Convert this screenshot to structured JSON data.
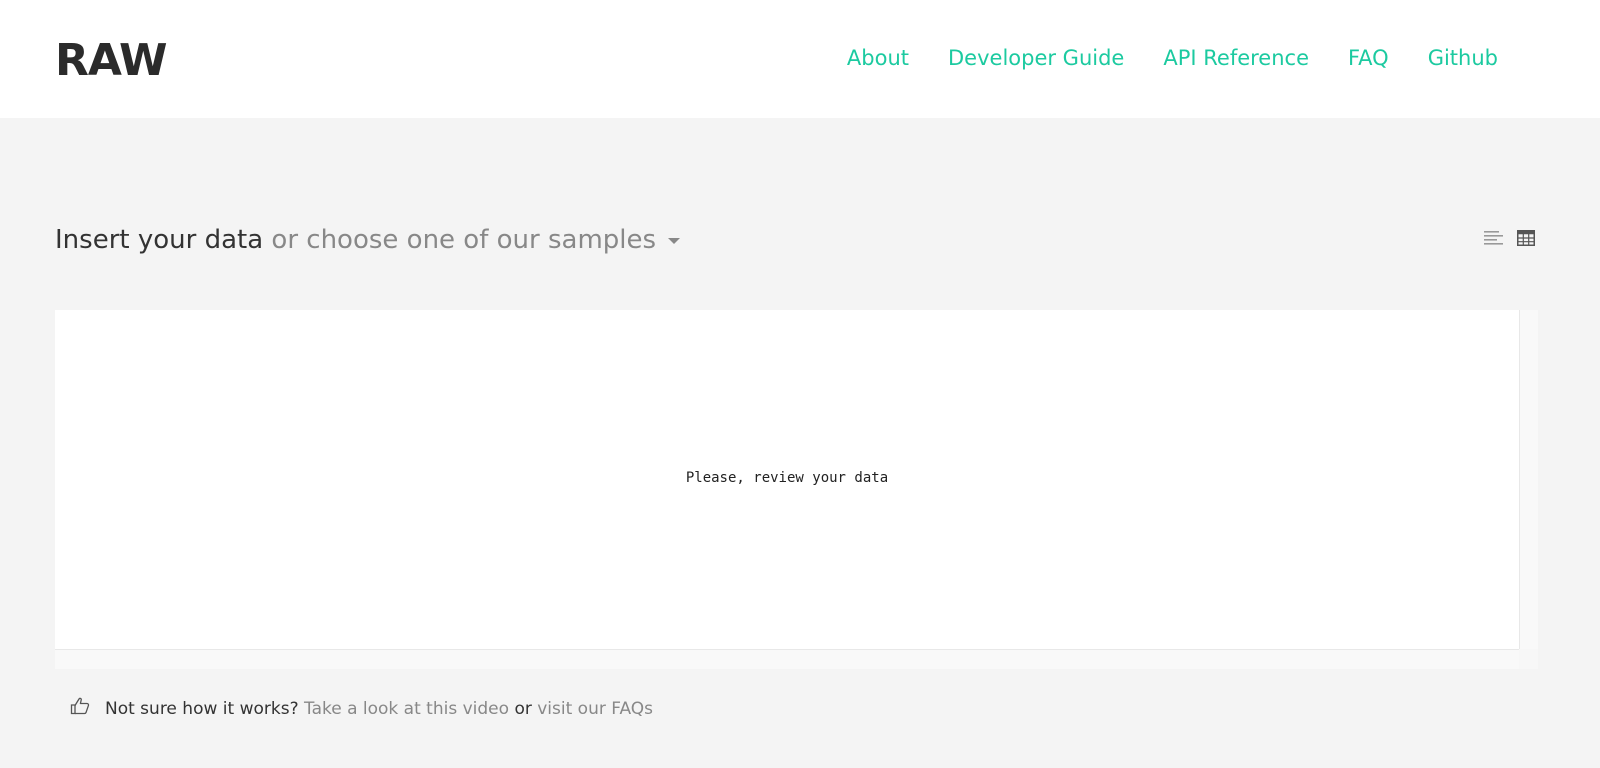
{
  "header": {
    "logo": "RAW",
    "nav": [
      "About",
      "Developer Guide",
      "API Reference",
      "FAQ",
      "Github"
    ]
  },
  "insert": {
    "title": "Insert your data",
    "samples_link": "or choose one of our samples",
    "view_icons": [
      "text-view-icon",
      "table-view-icon"
    ]
  },
  "data_area": {
    "message": "Please, review your data"
  },
  "help": {
    "icon": "thumbs-up-icon",
    "question": "Not sure how it works?",
    "video_link": "Take a look at this video",
    "or": "or",
    "faq_link": "visit our FAQs"
  },
  "colors": {
    "accent": "#1ccaa0",
    "background": "#f4f4f4",
    "muted_text": "#888888",
    "dark_text": "#333333"
  }
}
